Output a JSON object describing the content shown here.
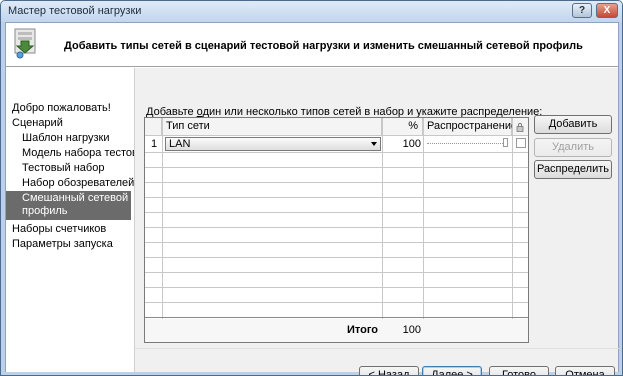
{
  "window": {
    "title": "Мастер тестовой нагрузки",
    "help_label": "?",
    "close_label": "X"
  },
  "header": {
    "text": "Добавить типы сетей в сценарий тестовой нагрузки и изменить смешанный сетевой профиль",
    "icon": "wizard-network-icon"
  },
  "nav": {
    "items": [
      {
        "label": "Добро пожаловать!",
        "level": 0
      },
      {
        "label": "Сценарий",
        "level": 0
      },
      {
        "label": "Шаблон нагрузки",
        "level": 1
      },
      {
        "label": "Модель набора тестов",
        "level": 1
      },
      {
        "label": "Тестовый набор",
        "level": 1
      },
      {
        "label": "Набор обозревателей",
        "level": 1
      },
      {
        "label": "Смешанный сетевой профиль",
        "level": 1,
        "selected": true
      },
      {
        "label": "Наборы счетчиков",
        "level": 0
      },
      {
        "label": "Параметры запуска",
        "level": 0
      }
    ]
  },
  "main": {
    "prompt_before": "Добавьте ",
    "prompt_underlined": "о",
    "prompt_after": "дин или несколько типов сетей в набор и укажите распределение:",
    "grid": {
      "headers": {
        "network": "Тип сети",
        "percent": "%",
        "distribution": "Распространение",
        "lock": "lock-icon"
      },
      "rows": [
        {
          "index": "1",
          "network": "LAN",
          "percent": "100",
          "distribution": 1.0
        }
      ],
      "total_label": "Итого",
      "total_value": "100"
    },
    "buttons": {
      "add": "Добавить",
      "remove": "Удалить",
      "distribute": "Распределить"
    }
  },
  "footer": {
    "back": "< Назад",
    "next": "Далее >",
    "finish": "Готово",
    "cancel": "Отмена"
  }
}
